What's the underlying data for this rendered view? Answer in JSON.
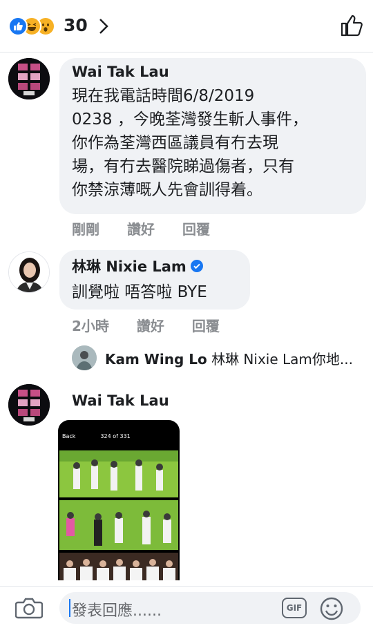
{
  "reactions": {
    "count": "30",
    "icons": [
      "like-icon",
      "haha-icon",
      "wow-icon"
    ],
    "like_color": "#1877f2",
    "emoji_color": "#f7b125"
  },
  "comments": [
    {
      "author": "Wai Tak Lau",
      "text": "現在我電話時間6/8/2019\n0238 ，今晚荃灣發生斬人事件，\n你作為荃灣西區議員有冇去現\n場，有冇去醫院睇過傷者，只有\n你禁涼薄嘅人先會訓得着。",
      "time": "剛剛",
      "like_label": "讚好",
      "reply_label": "回覆"
    },
    {
      "author": "林琳 Nixie Lam",
      "verified": true,
      "text": "訓覺啦 唔答啦 BYE",
      "time": "2小時",
      "like_label": "讚好",
      "reply_label": "回覆"
    }
  ],
  "reply_preview": {
    "author": "Kam Wing Lo",
    "text": "林琳 Nixie Lam你地..."
  },
  "attachment_comment": {
    "author": "Wai Tak Lau",
    "screenshot": {
      "back_label": "Back",
      "counter": "324 of 331"
    }
  },
  "composer": {
    "placeholder": "發表回應......",
    "gif_label": "GIF"
  },
  "colors": {
    "bubble": "#f0f2f5",
    "meta": "#8a8d91",
    "accent": "#1877f2"
  }
}
